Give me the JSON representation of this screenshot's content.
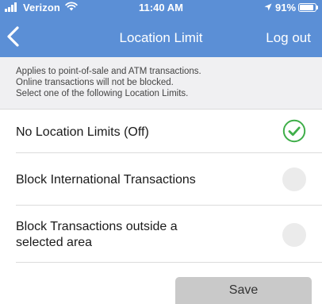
{
  "status_bar": {
    "carrier": "Verizon",
    "time": "11:40 AM",
    "battery": "91%",
    "battery_level": 0.91,
    "icons": [
      "signal-icon",
      "wifi-icon",
      "location-arrow-icon",
      "battery-icon"
    ]
  },
  "nav": {
    "back_icon": "chevron-left-icon",
    "title": "Location Limit",
    "logout_label": "Log out"
  },
  "info": {
    "line_1": "Applies to point-of-sale and ATM transactions.",
    "line_2": "Online transactions will not be blocked.",
    "line_3": "Select one of the following Location Limits."
  },
  "options": [
    {
      "label_1": "No Location Limits (Off)",
      "label_2": "",
      "selected": true
    },
    {
      "label_1": "Block International Transactions",
      "label_2": "",
      "selected": false
    },
    {
      "label_1": "Block Transactions outside a",
      "label_2": "selected area",
      "selected": false
    }
  ],
  "save_label": "Save",
  "colors": {
    "header_blue": "#5b8fd6",
    "check_green": "#3fae49",
    "save_gray": "#c9c9c9"
  }
}
